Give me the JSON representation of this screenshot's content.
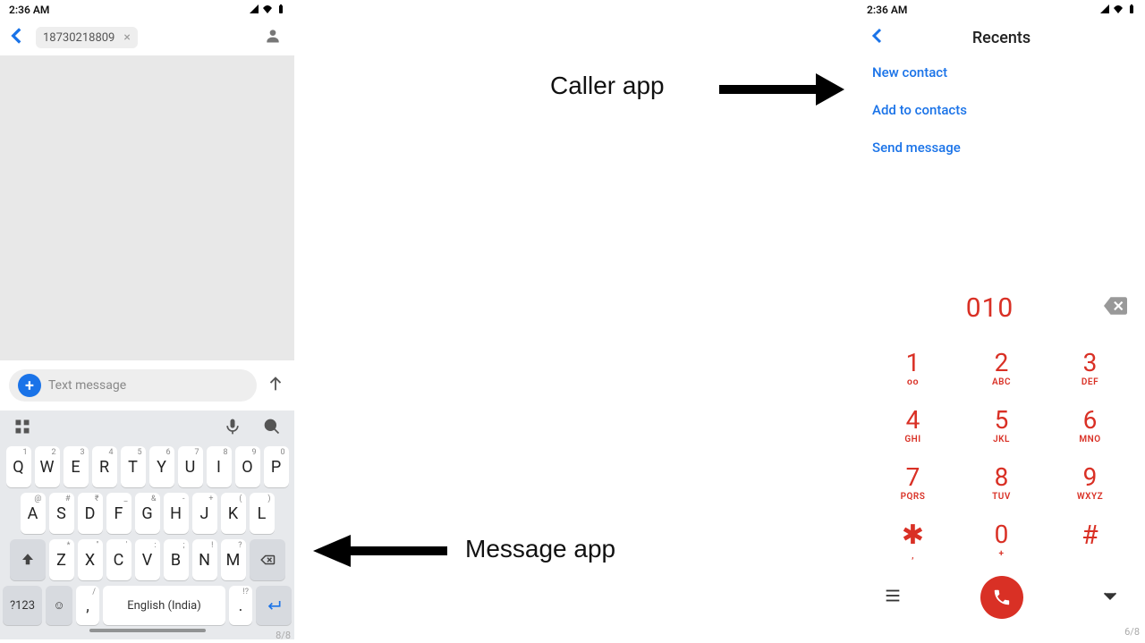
{
  "statusbar": {
    "time": "2:36 AM"
  },
  "message_app": {
    "chip_number": "18730218809",
    "compose_placeholder": "Text message",
    "space_label": "English (India)",
    "sym_key": "?123",
    "page_indicator": "8/8",
    "keys_r1": [
      {
        "m": "Q",
        "s": "1"
      },
      {
        "m": "W",
        "s": "2"
      },
      {
        "m": "E",
        "s": "3"
      },
      {
        "m": "R",
        "s": "4"
      },
      {
        "m": "T",
        "s": "5"
      },
      {
        "m": "Y",
        "s": "6"
      },
      {
        "m": "U",
        "s": "7"
      },
      {
        "m": "I",
        "s": "8"
      },
      {
        "m": "O",
        "s": "9"
      },
      {
        "m": "P",
        "s": "0"
      }
    ],
    "keys_r2": [
      {
        "m": "A",
        "s": "@"
      },
      {
        "m": "S",
        "s": "#"
      },
      {
        "m": "D",
        "s": "₹"
      },
      {
        "m": "F",
        "s": "_"
      },
      {
        "m": "G",
        "s": "&"
      },
      {
        "m": "H",
        "s": "-"
      },
      {
        "m": "J",
        "s": "+"
      },
      {
        "m": "K",
        "s": "("
      },
      {
        "m": "L",
        "s": ")"
      }
    ],
    "keys_r3": [
      {
        "m": "Z",
        "s": "*"
      },
      {
        "m": "X",
        "s": "\""
      },
      {
        "m": "C",
        "s": "'"
      },
      {
        "m": "V",
        "s": ":"
      },
      {
        "m": "B",
        "s": ";"
      },
      {
        "m": "N",
        "s": "!"
      },
      {
        "m": "M",
        "s": "?"
      }
    ],
    "comma_sup": "/",
    "dot_sup": "!?"
  },
  "caller_app": {
    "title": "Recents",
    "actions": {
      "new_contact": "New contact",
      "add": "Add to contacts",
      "send": "Send message"
    },
    "display": "010",
    "pad": [
      {
        "d": "1",
        "s": "ᴏᴏ"
      },
      {
        "d": "2",
        "s": "ABC"
      },
      {
        "d": "3",
        "s": "DEF"
      },
      {
        "d": "4",
        "s": "GHI"
      },
      {
        "d": "5",
        "s": "JKL"
      },
      {
        "d": "6",
        "s": "MNO"
      },
      {
        "d": "7",
        "s": "PQRS"
      },
      {
        "d": "8",
        "s": "TUV"
      },
      {
        "d": "9",
        "s": "WXYZ"
      },
      {
        "d": "✱",
        "s": ","
      },
      {
        "d": "0",
        "s": "+"
      },
      {
        "d": "#",
        "s": ""
      }
    ],
    "page_indicator": "6/8"
  },
  "annotations": {
    "caller_label": "Caller app",
    "message_label": "Message app"
  }
}
